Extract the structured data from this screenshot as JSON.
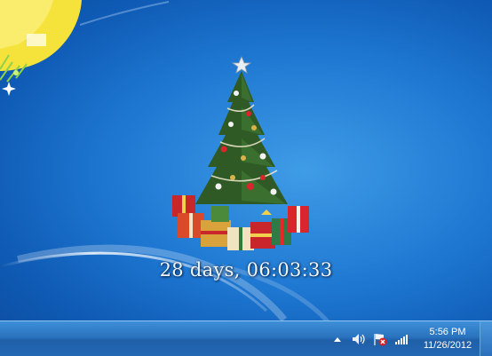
{
  "desktop": {
    "countdown_text": "28 days, 06:03:33"
  },
  "taskbar": {
    "clock_time": "5:56 PM",
    "clock_date": "11/26/2012",
    "tray_icons": [
      "show-hidden-icons",
      "volume-icon",
      "action-center-flag-icon",
      "network-signal-icon"
    ]
  }
}
